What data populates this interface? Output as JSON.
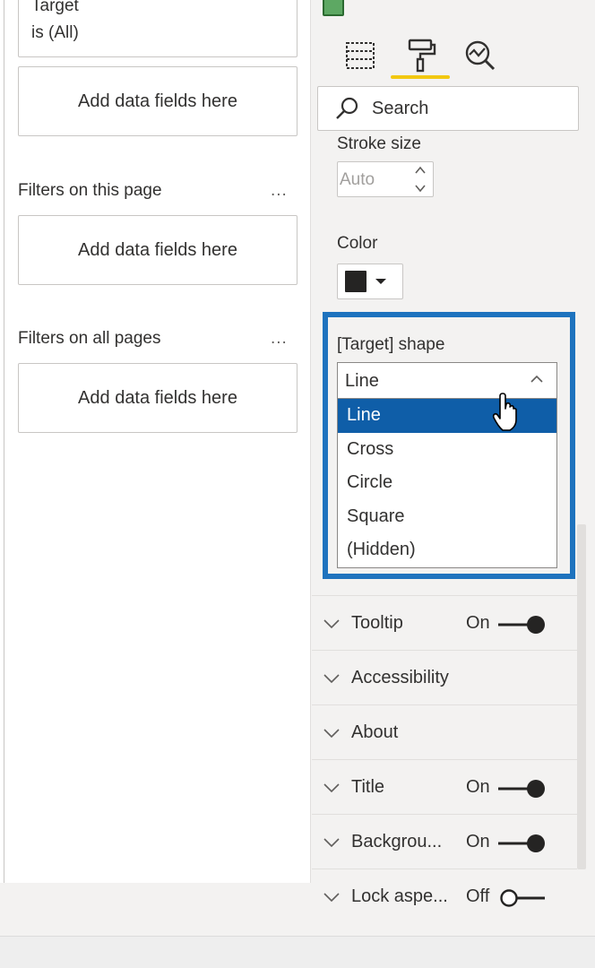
{
  "filters": {
    "target_card": {
      "title": "Target",
      "value": "is (All)"
    },
    "drop_zone_text": "Add data fields here",
    "page_section": {
      "label": "Filters on this page",
      "more": "..."
    },
    "all_section": {
      "label": "Filters on all pages",
      "more": "..."
    }
  },
  "format_pane": {
    "tab_icons": [
      "fields-icon",
      "format-paint-roller-icon",
      "analytics-magnifier-icon"
    ],
    "active_tab": "format-paint-roller-icon",
    "search": {
      "placeholder": "Search"
    },
    "stroke_size": {
      "label": "Stroke size",
      "value": "Auto"
    },
    "color": {
      "label": "Color",
      "value": "#252423"
    },
    "target_shape": {
      "label": "[Target] shape",
      "selected": "Line",
      "options": [
        "Line",
        "Cross",
        "Circle",
        "Square",
        "(Hidden)"
      ]
    },
    "sections": [
      {
        "label": "Tooltip",
        "toggle": "On"
      },
      {
        "label": "Accessibility"
      },
      {
        "label": "About"
      },
      {
        "label": "Title",
        "toggle": "On"
      },
      {
        "label": "Backgrou...",
        "toggle": "On"
      },
      {
        "label": "Lock aspe...",
        "toggle": "Off"
      }
    ]
  },
  "colors": {
    "highlight": "#1e73be",
    "selected_option": "#0f5ea8",
    "active_tab_underline": "#f2c811"
  }
}
